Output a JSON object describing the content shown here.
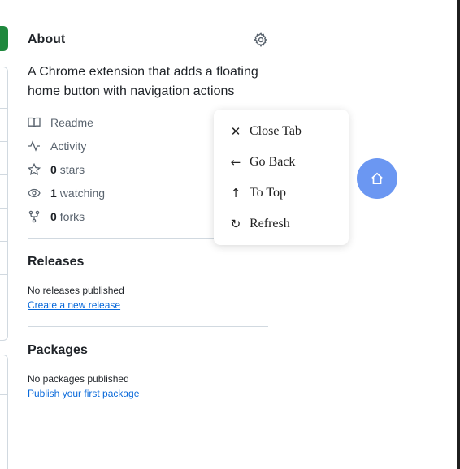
{
  "about": {
    "title": "About",
    "description": "A Chrome extension that adds a floating home button with navigation actions"
  },
  "meta": {
    "readme": "Readme",
    "activity": "Activity",
    "stars_count": "0",
    "stars_label": "stars",
    "watching_count": "1",
    "watching_label": "watching",
    "forks_count": "0",
    "forks_label": "forks"
  },
  "releases": {
    "title": "Releases",
    "empty": "No releases published",
    "link": "Create a new release"
  },
  "packages": {
    "title": "Packages",
    "empty": "No packages published",
    "link": "Publish your first package"
  },
  "float_menu": {
    "items": [
      {
        "icon": "close-icon",
        "glyph": "✕",
        "label": "Close Tab"
      },
      {
        "icon": "arrow-left-icon",
        "glyph": "←",
        "label": "Go Back"
      },
      {
        "icon": "arrow-up-icon",
        "glyph": "↑",
        "label": "To Top"
      },
      {
        "icon": "refresh-icon",
        "glyph": "↻",
        "label": "Refresh"
      }
    ]
  },
  "fab": {
    "icon": "home-icon",
    "glyph": "⌂",
    "color": "#6b97f2"
  },
  "colors": {
    "link": "#0969da",
    "muted": "#59636e",
    "accent_green": "#1f883d"
  }
}
